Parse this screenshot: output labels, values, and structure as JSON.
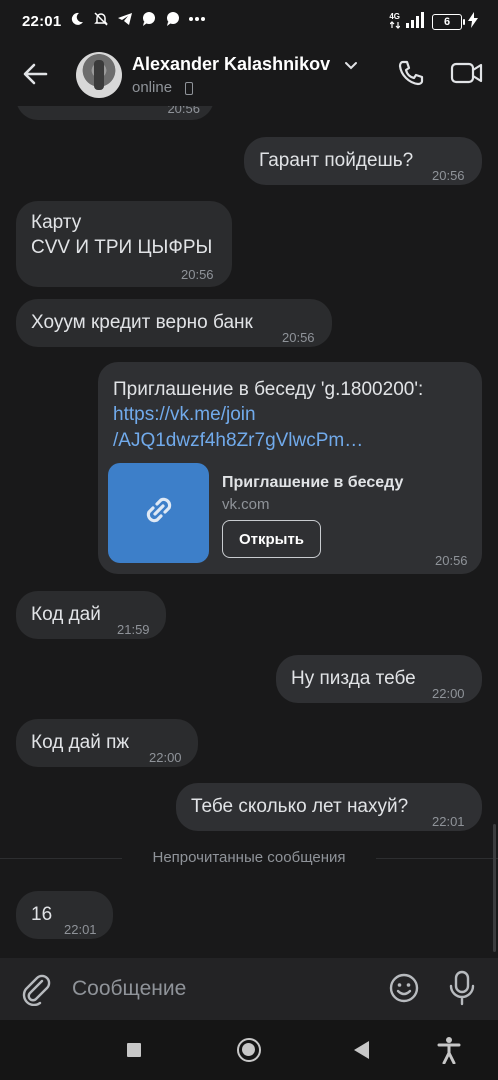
{
  "status_bar": {
    "time": "22:01",
    "network": "4G",
    "battery": "6",
    "icons": [
      "moon-icon",
      "muted-bell-icon",
      "telegram-icon",
      "chat-icon",
      "chat-bubble-icon",
      "more-dots-icon",
      "signal-icon",
      "charging-icon"
    ]
  },
  "header": {
    "name": "Alexander Kalashnikov",
    "status": "online",
    "icons": [
      "back-arrow-icon",
      "chevron-down-icon",
      "phone-call-icon",
      "video-call-icon"
    ]
  },
  "messages": [
    {
      "id": "m1",
      "dir": "out",
      "text": "Гарант пойдешь?",
      "time": "20:56"
    },
    {
      "id": "m2",
      "dir": "in",
      "lines": [
        "Карту",
        "CVV И ТРИ ЦЫФРЫ"
      ],
      "time": "20:56"
    },
    {
      "id": "m3",
      "dir": "in",
      "text": "Хоуум кредит верно банк",
      "time": "20:56"
    },
    {
      "id": "m4",
      "dir": "out",
      "text": "Приглашение в беседу 'g.1800200':",
      "link_lines": [
        "https://vk.me/join",
        "/AJQ1dwzf4h8Zr7gVlwcPm…"
      ],
      "card_title": "Приглашение в беседу",
      "card_domain": "vk.com",
      "card_button": "Открыть",
      "time": "20:56"
    },
    {
      "id": "m5",
      "dir": "in",
      "text": "Код дай",
      "time": "21:59"
    },
    {
      "id": "m6",
      "dir": "out",
      "text": "Ну пизда тебе",
      "time": "22:00"
    },
    {
      "id": "m7",
      "dir": "in",
      "text": "Код дай пж",
      "time": "22:00"
    },
    {
      "id": "m8",
      "dir": "out",
      "text": "Тебе сколько лет нахуй?",
      "time": "22:01"
    },
    {
      "id": "m9",
      "dir": "in",
      "text": "16",
      "time": "22:01"
    }
  ],
  "partial_top_time": "20:56",
  "unread_divider": "Непрочитанные сообщения",
  "composer": {
    "placeholder": "Сообщение",
    "icons": [
      "attach-icon",
      "emoji-icon",
      "microphone-icon"
    ]
  },
  "nav": [
    "recents-button",
    "home-button",
    "back-button",
    "accessibility-button"
  ],
  "colors": {
    "background": "#19191a",
    "bubble": "#2b2c2e",
    "link": "#71aaeb",
    "card_image": "#3d7fc9",
    "secondary_text": "#8f9399"
  }
}
